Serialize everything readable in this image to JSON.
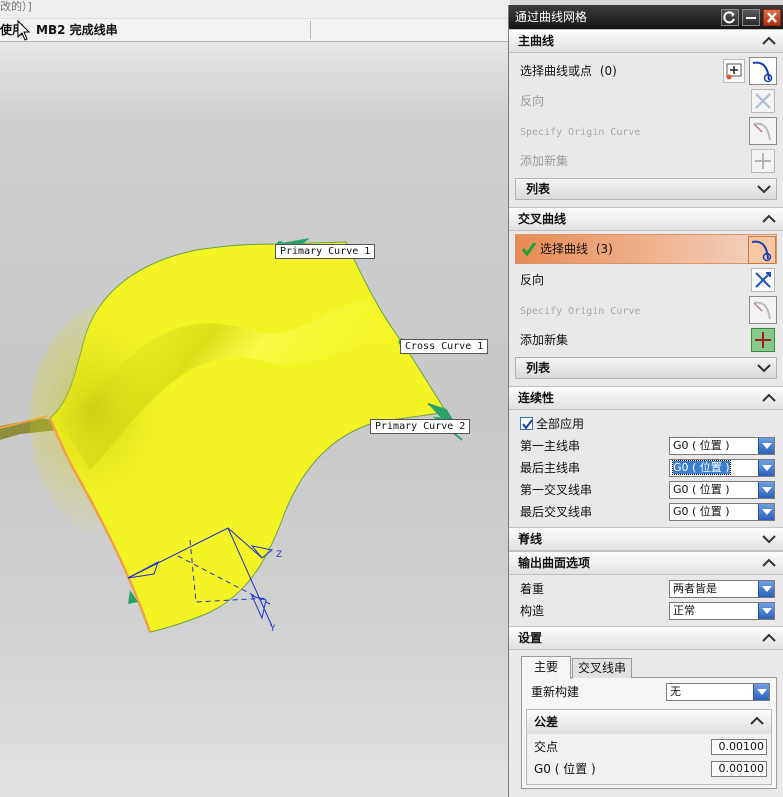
{
  "viewport": {
    "top_text": "改的）]",
    "status_prefix": "使用",
    "status_text": "MB2 完成线串",
    "labels": {
      "primary1": "Primary Curve  1",
      "cross1": "Cross Curve  1",
      "primary2": "Primary Curve  2"
    },
    "axis_z": "Z",
    "axis_y": "Y"
  },
  "dialog": {
    "title": "通过曲线网格",
    "primary": {
      "header": "主曲线",
      "select_label": "选择曲线或点",
      "select_count": "(0)",
      "reverse": "反向",
      "origin": "Specify Origin Curve",
      "add_set": "添加新集",
      "list": "列表"
    },
    "cross": {
      "header": "交叉曲线",
      "select_label": "选择曲线",
      "select_count": "(3)",
      "reverse": "反向",
      "origin": "Specify Origin Curve",
      "add_set": "添加新集",
      "list": "列表"
    },
    "continuity": {
      "header": "连续性",
      "apply_all": "全部应用",
      "first_primary": "第一主线串",
      "last_primary": "最后主线串",
      "first_cross": "第一交叉线串",
      "last_cross": "最后交叉线串",
      "value": "G0 ( 位置 )"
    },
    "spine": {
      "header": "脊线"
    },
    "output": {
      "header": "输出曲面选项",
      "emphasis_label": "着重",
      "emphasis_value": "两者皆是",
      "construct_label": "构造",
      "construct_value": "正常"
    },
    "settings": {
      "header": "设置",
      "tab_main": "主要",
      "tab_cross": "交叉线串",
      "rebuild_label": "重新构建",
      "rebuild_value": "无",
      "tolerance_header": "公差",
      "intersection_label": "交点",
      "intersection_value": "0.00100",
      "g0_label": "G0 ( 位置 )",
      "g0_value": "0.00100"
    }
  },
  "colors": {
    "surface": "#f4f424",
    "surface_shade": "#c9c90e",
    "edge": "#f0a04a",
    "selection": "#e98a54",
    "titlebar": "#1f1f1f",
    "dropdown_arrow": "#2c60b8"
  }
}
